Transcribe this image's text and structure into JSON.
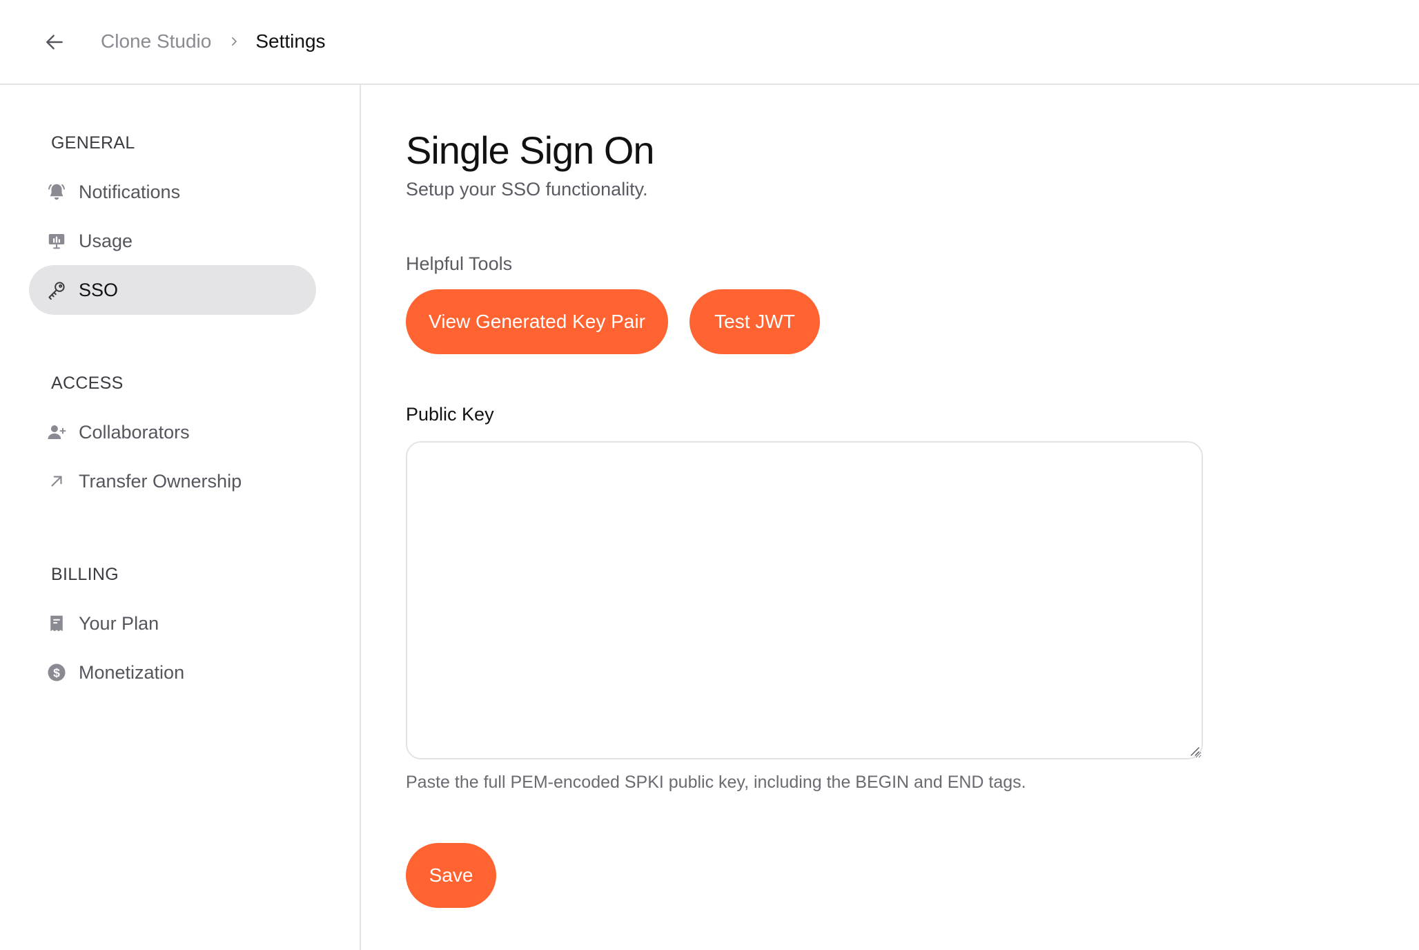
{
  "header": {
    "back_icon": "arrow-left-icon",
    "breadcrumb": {
      "root": "Clone Studio",
      "separator_icon": "chevron-right-icon",
      "current": "Settings"
    }
  },
  "sidebar": {
    "sections": [
      {
        "title": "GENERAL",
        "items": [
          {
            "label": "Notifications",
            "icon": "bell-icon",
            "active": false
          },
          {
            "label": "Usage",
            "icon": "chart-icon",
            "active": false
          },
          {
            "label": "SSO",
            "icon": "key-icon",
            "active": true
          }
        ]
      },
      {
        "title": "ACCESS",
        "items": [
          {
            "label": "Collaborators",
            "icon": "user-plus-icon",
            "active": false
          },
          {
            "label": "Transfer Ownership",
            "icon": "arrow-up-right-icon",
            "active": false
          }
        ]
      },
      {
        "title": "BILLING",
        "items": [
          {
            "label": "Your Plan",
            "icon": "receipt-icon",
            "active": false
          },
          {
            "label": "Monetization",
            "icon": "dollar-icon",
            "active": false
          }
        ]
      }
    ]
  },
  "main": {
    "title": "Single Sign On",
    "subtitle": "Setup your SSO functionality.",
    "tools_label": "Helpful Tools",
    "tools": {
      "keypair_label": "View Generated Key Pair",
      "jwt_label": "Test JWT"
    },
    "public_key": {
      "label": "Public Key",
      "value": "",
      "placeholder": "",
      "helper": "Paste the full PEM-encoded SPKI public key, including the BEGIN and END tags."
    },
    "save_label": "Save"
  },
  "colors": {
    "accent": "#ff6331",
    "active_nav_bg": "#e4e4e7",
    "border": "#e3e3e6",
    "muted_text": "#8a8a93"
  }
}
